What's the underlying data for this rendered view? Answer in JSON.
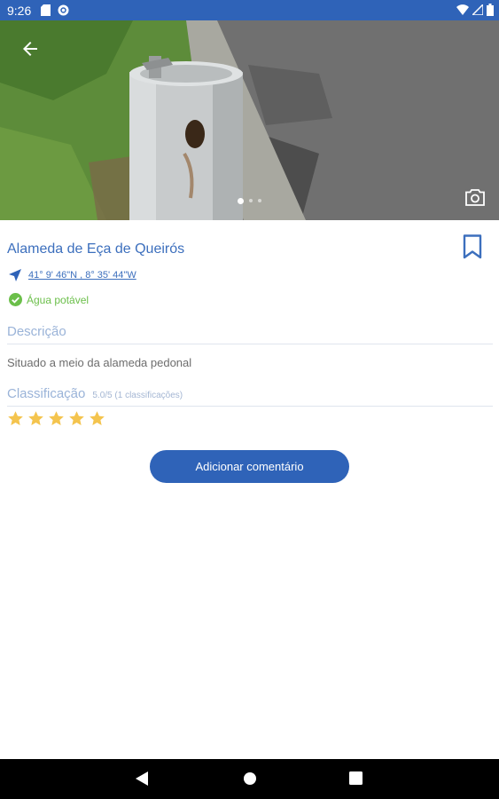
{
  "status_bar": {
    "time": "9:26"
  },
  "hero": {
    "slide_count": 3,
    "active_slide": 1
  },
  "fountain": {
    "title": "Alameda de Eça de Queirós",
    "coordinates": "41° 9' 46\"N , 8° 35' 44\"W",
    "water_status": "Água potável",
    "water_status_color": "#6bbf4a"
  },
  "description": {
    "heading": "Descrição",
    "text": "Situado a meio da alameda pedonal"
  },
  "rating": {
    "heading": "Classificação",
    "summary": "5.0/5 (1 classificações)",
    "stars_filled": 5,
    "stars_total": 5
  },
  "actions": {
    "add_comment_label": "Adicionar comentário"
  },
  "colors": {
    "primary": "#2f63b8",
    "title_blue": "#3c6fbd",
    "star": "#f4c44e"
  },
  "icons": [
    "back-arrow-icon",
    "camera-icon",
    "bookmark-icon",
    "navigation-icon",
    "check-circle-icon",
    "star-icon"
  ]
}
